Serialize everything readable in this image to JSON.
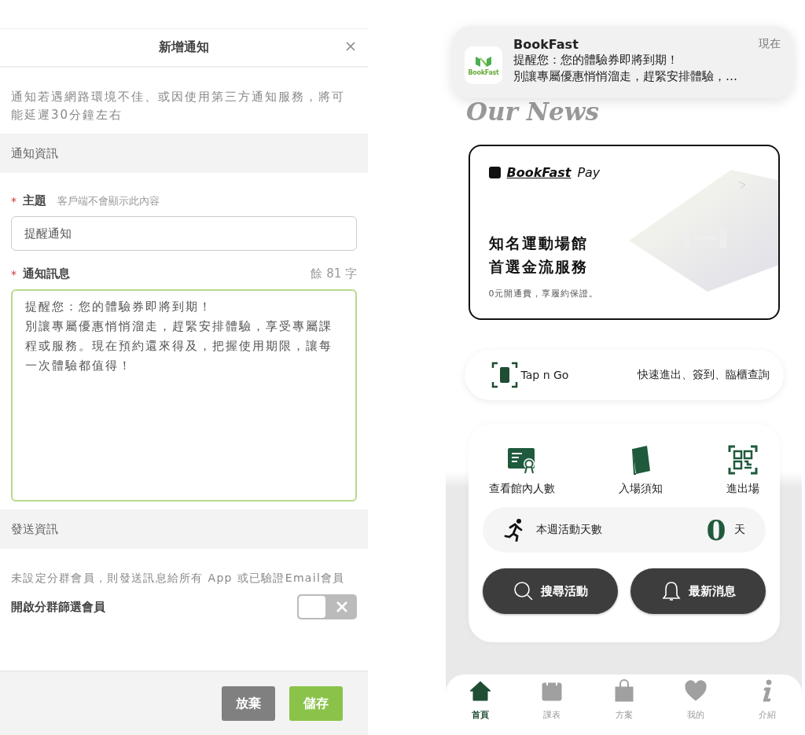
{
  "form": {
    "title": "新增通知",
    "notice": "通知若遇網路環境不佳、或因使用第三方通知服務，將可能延遲30分鐘左右",
    "sections": [
      {
        "heading": "通知資訊",
        "fields": [
          {
            "kind": "input",
            "marker": "*",
            "label": "主題",
            "hint": "客戶端不會顯示此內容",
            "value": "提醒通知"
          },
          {
            "kind": "textarea",
            "marker": "*",
            "label": "通知訊息",
            "counter": "餘 81 字",
            "lines": [
              "提醒您：您的體驗券即將到期！",
              "別讓專屬優惠悄悄溜走，趕緊安排體驗，享受專屬課程或服務。現在預約還來得及，把握使用期限，讓每一次體驗都值得！"
            ]
          }
        ]
      },
      {
        "heading": "發送資訊",
        "fields": [
          {
            "kind": "note",
            "text": "未設定分群會員，則發送訊息給所有 App 或已驗證Email會員"
          },
          {
            "kind": "toggle",
            "label": "開啟分群篩選會員",
            "on": false
          }
        ]
      }
    ],
    "buttons": [
      {
        "label": "放棄",
        "kind": "secondary"
      },
      {
        "label": "儲存",
        "kind": "primary"
      }
    ]
  },
  "app": {
    "notification": {
      "app": "BookFast",
      "icon_label": "BookFast",
      "time": "現在",
      "lines": [
        "提醒您：您的體驗券即將到期！",
        "別讓專屬優惠悄悄溜走，趕緊安排體驗，…"
      ]
    },
    "heading": "Our News",
    "pay_card": {
      "brand": "BookFast",
      "brand_suffix": "Pay",
      "headline": [
        "知名運動場館",
        "首選金流服務"
      ],
      "subtext": "0元開通費，享履約保證。"
    },
    "tap": {
      "label": "Tap n Go",
      "description": "快速進出、簽到、臨櫃查詢"
    },
    "actions": [
      {
        "kind": "certificate",
        "label": "查看館內人數"
      },
      {
        "kind": "book",
        "label": "入場須知"
      },
      {
        "kind": "qr",
        "label": "進出場"
      }
    ],
    "weekly": {
      "label": "本週活動天數",
      "value": "0",
      "unit": "天"
    },
    "buttons": [
      {
        "kind": "search",
        "label": "搜尋活動"
      },
      {
        "kind": "bell",
        "label": "最新消息"
      }
    ],
    "tabs": [
      {
        "kind": "home",
        "label": "首頁",
        "selected": true
      },
      {
        "kind": "calendar",
        "label": "課表",
        "selected": false
      },
      {
        "kind": "bag",
        "label": "方案",
        "selected": false
      },
      {
        "kind": "heart",
        "label": "我的",
        "selected": false
      },
      {
        "kind": "info",
        "label": "介紹",
        "selected": false
      }
    ]
  }
}
